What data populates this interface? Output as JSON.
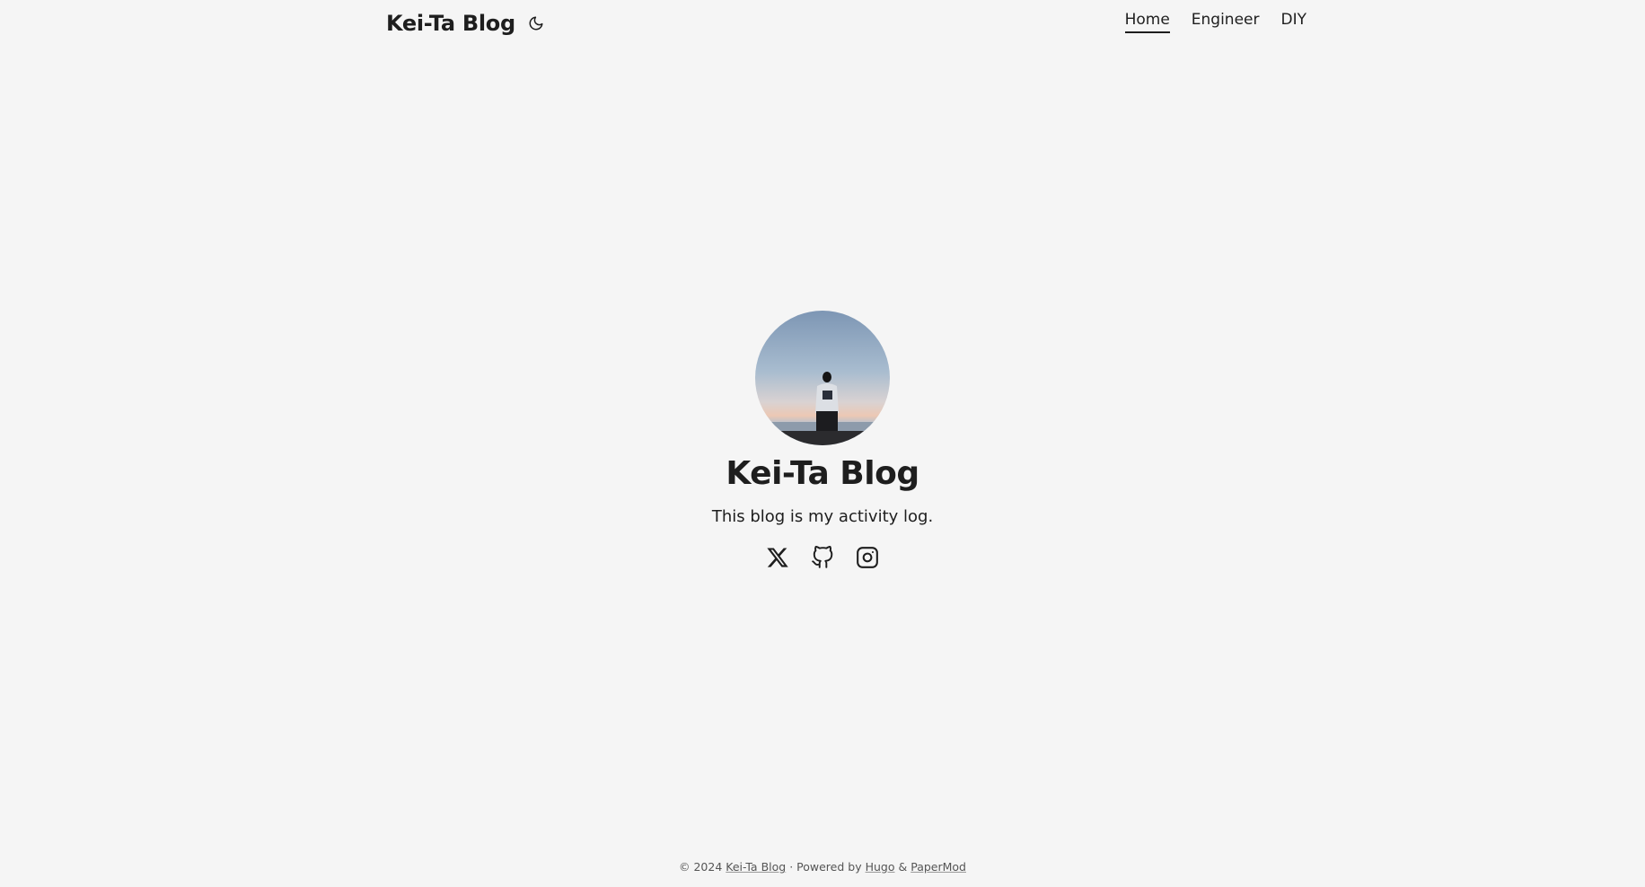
{
  "header": {
    "logo_text": "Kei-Ta Blog",
    "theme_toggle_icon": "moon-icon",
    "menu": [
      {
        "label": "Home",
        "active": true
      },
      {
        "label": "Engineer",
        "active": false
      },
      {
        "label": "DIY",
        "active": false
      }
    ]
  },
  "profile": {
    "avatar_alt": "profile-photo",
    "title": "Kei-Ta Blog",
    "subtitle": "This blog is my activity log.",
    "social_icons": [
      "x-icon",
      "github-icon",
      "instagram-icon"
    ]
  },
  "footer": {
    "copyright": "© 2024",
    "site_link": "Kei-Ta Blog",
    "separator": "·",
    "powered_by": "Powered by",
    "hugo_link": "Hugo",
    "ampersand": "&",
    "theme_link": "PaperMod"
  },
  "colors": {
    "background": "#f5f5f5",
    "text": "#1e1e1e",
    "footer_text": "#555555"
  }
}
